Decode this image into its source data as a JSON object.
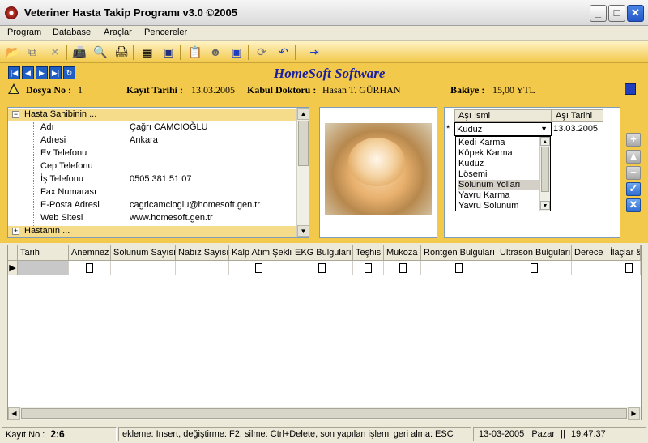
{
  "window": {
    "title": "Veteriner Hasta Takip Programı  v3.0  ©2005",
    "min_label": "_",
    "max_label": "□",
    "close_label": "✕"
  },
  "menu": [
    "Program",
    "Database",
    "Araçlar",
    "Pencereler"
  ],
  "toolbar_icons": [
    "open-folder-icon",
    "copy-icon",
    "delete-icon",
    "fax-icon",
    "preview-icon",
    "print-icon",
    "calendar-icon",
    "calculator-icon",
    "paste-icon",
    "smiley-icon",
    "save-icon",
    "refresh-icon",
    "undo-icon",
    "exit-door-icon"
  ],
  "brand": "HomeSoft Software",
  "nav": [
    "|◀",
    "◀",
    "▶",
    "▶|",
    "↻"
  ],
  "record": {
    "dosya_label": "Dosya No :",
    "dosya_value": "1",
    "kayit_label": "Kayıt Tarihi :",
    "kayit_value": "13.03.2005",
    "doktor_label": "Kabul Doktoru :",
    "doktor_value": "Hasan T. GÜRHAN",
    "bakiye_label": "Bakiye :",
    "bakiye_value": "15,00 YTL"
  },
  "owner_tree": {
    "group_label": "Hasta Sahibinin ...",
    "fields": [
      {
        "label": "Adı",
        "value": "Çağrı CAMCIOĞLU"
      },
      {
        "label": "Adresi",
        "value": "Ankara"
      },
      {
        "label": "Ev Telefonu",
        "value": ""
      },
      {
        "label": "Cep Telefonu",
        "value": ""
      },
      {
        "label": "İş Telefonu",
        "value": "0505 381 51 07"
      },
      {
        "label": "Fax Numarası",
        "value": ""
      },
      {
        "label": "E-Posta Adresi",
        "value": "cagricamcioglu@homesoft.gen.tr"
      },
      {
        "label": "Web Sitesi",
        "value": "www.homesoft.gen.tr"
      }
    ],
    "group2_label": "Hastanın ..."
  },
  "vaccine": {
    "col1": "Aşı İsmi",
    "col2": "Aşı Tarihi",
    "row_marker": "*",
    "current_name": "Kuduz",
    "current_date": "13.03.2005",
    "options": [
      "Kedi Karma",
      "Köpek Karma",
      "Kuduz",
      "Lösemi",
      "Solunum Yolları",
      "Yavru Karma",
      "Yavru Solunum"
    ],
    "selected_index": 4
  },
  "grid": {
    "columns": [
      "Tarih",
      "Anemnez",
      "Solunum Sayısı",
      "Nabız Sayısı",
      "Kalp Atım Şekli",
      "EKG Bulguları",
      "Teşhis",
      "Mukoza",
      "Rontgen Bulguları",
      "Ultrason Bulguları",
      "Derece",
      "İlaçlar &"
    ],
    "row_pointer": "▶"
  },
  "status": {
    "kayit_label": "Kayıt No :",
    "kayit_value": "2:6",
    "hint": "ekleme: Insert, değiştirme: F2, silme: Ctrl+Delete, son yapılan işlemi geri alma: ESC",
    "date": "13-03-2005",
    "day": "Pazar",
    "sep": "||",
    "time": "19:47:37"
  },
  "colors": {
    "accent_yellow": "#f2c94a",
    "brand_blue": "#1c1f9e",
    "nav_blue": "#1f5fc4"
  }
}
